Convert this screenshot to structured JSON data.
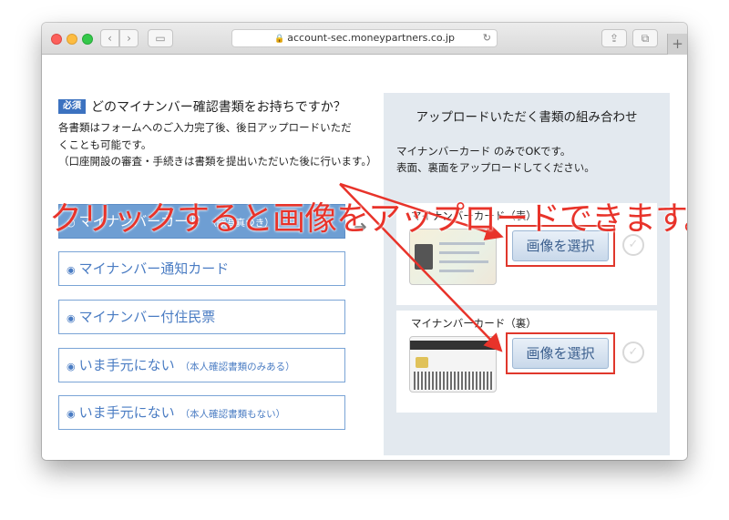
{
  "browser": {
    "url": "account-sec.moneypartners.co.jp",
    "plus_tab": "+"
  },
  "form": {
    "required_badge": "必須",
    "question": "どのマイナンバー確認書類をお持ちですか？",
    "description_line1": "各書類はフォームへのご入力完了後、後日アップロードいただくことも可能です。",
    "description_line2": "（口座開設の審査・手続きは書類を提出いただいた後に行います。）",
    "options": [
      {
        "label": "マイナンバーカード",
        "note": "（顔写真つき）",
        "selected": true
      },
      {
        "label": "マイナンバー通知カード",
        "note": "",
        "selected": false
      },
      {
        "label": "マイナンバー付住民票",
        "note": "",
        "selected": false
      },
      {
        "label": "いま手元にない",
        "note": "（本人確認書類のみある）",
        "selected": false
      },
      {
        "label": "いま手元にない",
        "note": "（本人確認書類もない）",
        "selected": false
      }
    ]
  },
  "upload_panel": {
    "title": "アップロードいただく書類の組み合わせ",
    "desc_line1": "マイナンバーカード のみでOKです。",
    "desc_line2": "表面、裏面をアップロードしてください。",
    "cards": [
      {
        "label": "マイナンバーカード（表）",
        "button": "画像を選択"
      },
      {
        "label": "マイナンバーカード（裏）",
        "button": "画像を選択"
      }
    ]
  },
  "annotation": {
    "text": "クリックすると画像をアップロードできます。",
    "color": "#e8332a"
  },
  "colors": {
    "accent": "#6e9ed3",
    "badge": "#3c72c0",
    "highlight": "#e0372c"
  }
}
